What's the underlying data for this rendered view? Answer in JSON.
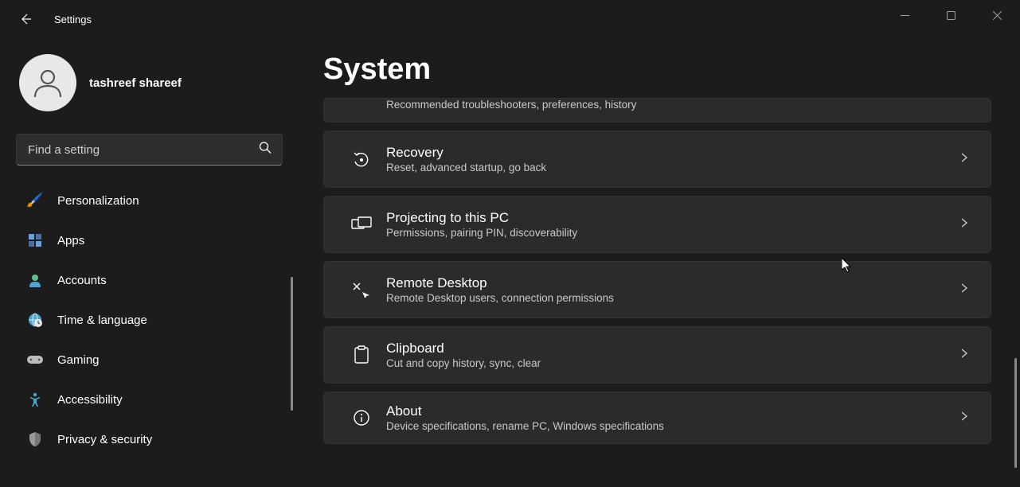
{
  "app_title": "Settings",
  "user": {
    "name": "tashreef shareef"
  },
  "search": {
    "placeholder": "Find a setting"
  },
  "sidebar": {
    "items": [
      {
        "icon": "🖌️",
        "label": "Personalization"
      },
      {
        "icon": "apps",
        "label": "Apps"
      },
      {
        "icon": "👤",
        "label": "Accounts"
      },
      {
        "icon": "🌐",
        "label": "Time & language"
      },
      {
        "icon": "🎮",
        "label": "Gaming"
      },
      {
        "icon": "person",
        "label": "Accessibility"
      },
      {
        "icon": "🛡️",
        "label": "Privacy & security"
      }
    ]
  },
  "page_title": "System",
  "cards": {
    "troubleshoot": {
      "title": "",
      "desc": "Recommended troubleshooters, preferences, history"
    },
    "recovery": {
      "title": "Recovery",
      "desc": "Reset, advanced startup, go back"
    },
    "projecting": {
      "title": "Projecting to this PC",
      "desc": "Permissions, pairing PIN, discoverability"
    },
    "remote": {
      "title": "Remote Desktop",
      "desc": "Remote Desktop users, connection permissions"
    },
    "clipboard": {
      "title": "Clipboard",
      "desc": "Cut and copy history, sync, clear"
    },
    "about": {
      "title": "About",
      "desc": "Device specifications, rename PC, Windows specifications"
    }
  }
}
